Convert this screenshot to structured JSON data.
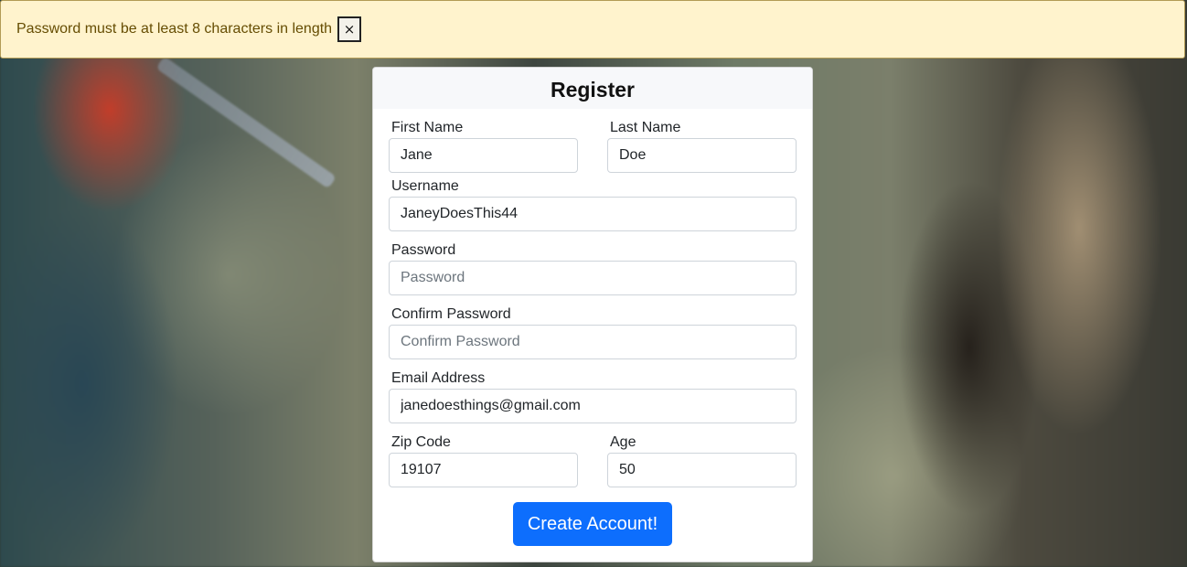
{
  "alert": {
    "message": "Password must be at least 8 characters in length",
    "close_label": "×"
  },
  "form": {
    "title": "Register",
    "first_name": {
      "label": "First Name",
      "value": "Jane",
      "placeholder": ""
    },
    "last_name": {
      "label": "Last Name",
      "value": "Doe",
      "placeholder": ""
    },
    "username": {
      "label": "Username",
      "value": "JaneyDoesThis44",
      "placeholder": ""
    },
    "password": {
      "label": "Password",
      "value": "",
      "placeholder": "Password"
    },
    "confirm_password": {
      "label": "Confirm Password",
      "value": "",
      "placeholder": "Confirm Password"
    },
    "email": {
      "label": "Email Address",
      "value": "janedoesthings@gmail.com",
      "placeholder": ""
    },
    "zip": {
      "label": "Zip Code",
      "value": "19107",
      "placeholder": ""
    },
    "age": {
      "label": "Age",
      "value": "50",
      "placeholder": ""
    },
    "submit_label": "Create Account!"
  },
  "colors": {
    "alert_bg": "#fff3cd",
    "alert_text": "#664d03",
    "primary": "#0d6efd"
  }
}
